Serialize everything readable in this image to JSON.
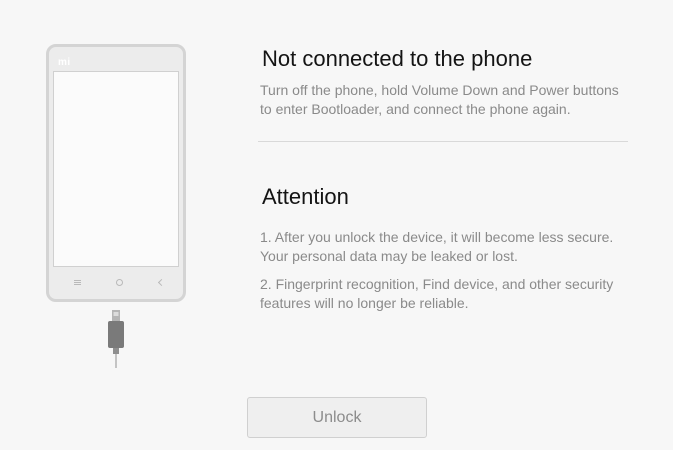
{
  "phone": {
    "logo": "mi",
    "nav_buttons": [
      "menu-icon",
      "home-icon",
      "back-icon"
    ]
  },
  "status": {
    "title": "Not connected to the phone",
    "instructions": "Turn off the phone, hold Volume Down and Power buttons to enter Bootloader, and connect the phone again."
  },
  "attention": {
    "title": "Attention",
    "notes": [
      "1. After you unlock the device, it will become less secure. Your personal data may be leaked or lost.",
      "2. Fingerprint recognition, Find device, and other security features will no longer be reliable."
    ]
  },
  "actions": {
    "unlock_label": "Unlock"
  },
  "colors": {
    "background": "#f7f7f7",
    "title_text": "#141414",
    "body_text": "#8a8a8a",
    "phone_frame": "#d4d4d4",
    "button_bg": "#efefef"
  }
}
